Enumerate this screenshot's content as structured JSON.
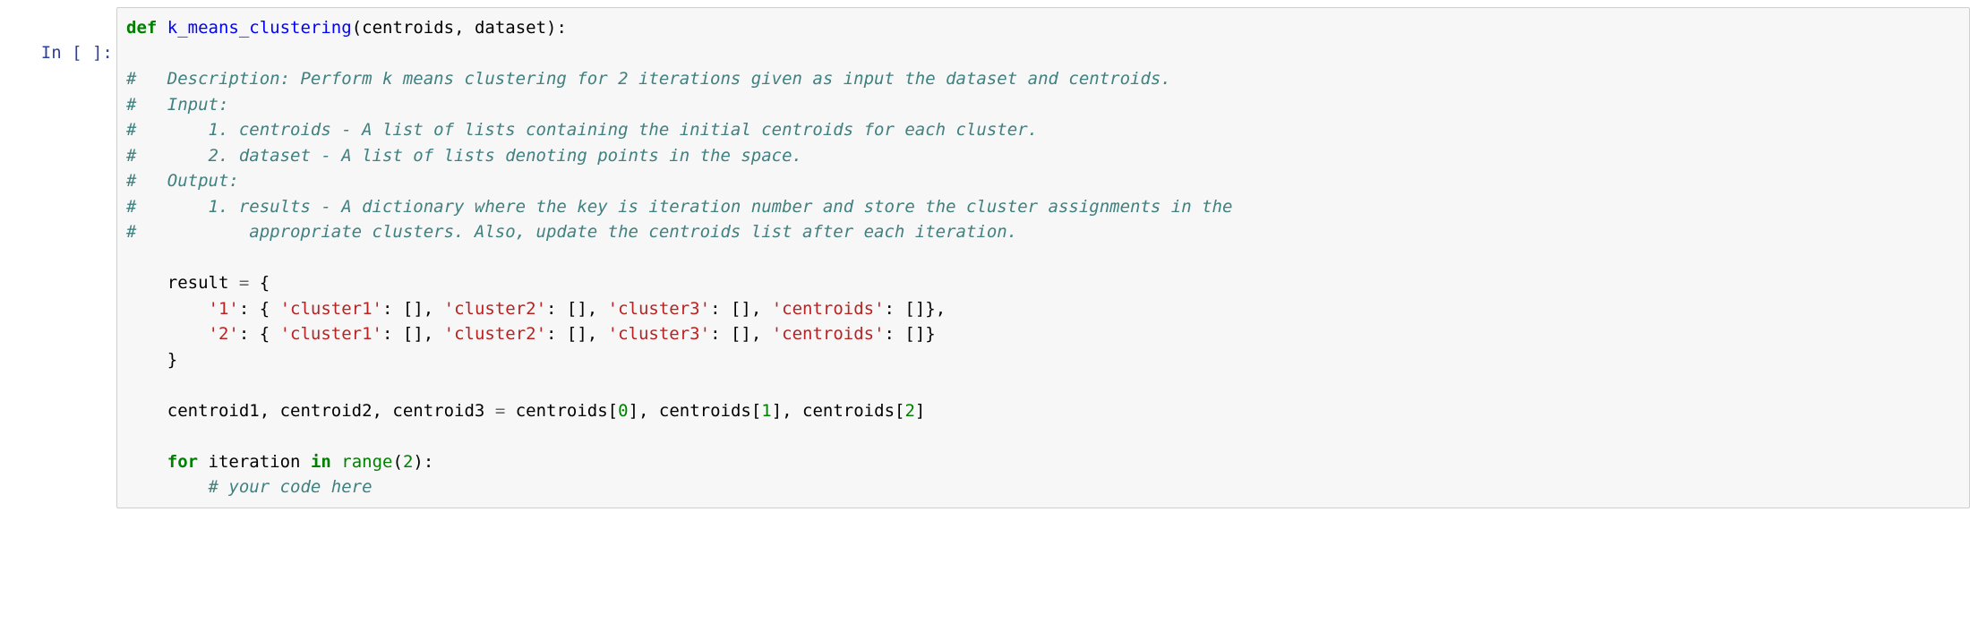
{
  "cell": {
    "prompt": "In [ ]:",
    "code": {
      "l1": {
        "def": "def",
        "name": "k_means_clustering",
        "params": "(centroids, dataset):"
      },
      "l2": "",
      "l3": "#   Description: Perform k means clustering for 2 iterations given as input the dataset and centroids.",
      "l4": "#   Input:",
      "l5": "#       1. centroids - A list of lists containing the initial centroids for each cluster. ",
      "l6": "#       2. dataset - A list of lists denoting points in the space.",
      "l7": "#   Output:",
      "l8": "#       1. results - A dictionary where the key is iteration number and store the cluster assignments in the ",
      "l9": "#           appropriate clusters. Also, update the centroids list after each iteration.",
      "l10": "",
      "l11": {
        "pre": "    result ",
        "op": "=",
        "post": " {"
      },
      "l12": {
        "indent": "        ",
        "s1": "'1'",
        "c1": ": { ",
        "s2": "'cluster1'",
        "c2": ": [], ",
        "s3": "'cluster2'",
        "c3": ": [], ",
        "s4": "'cluster3'",
        "c4": ": [], ",
        "s5": "'centroids'",
        "c5": ": []},"
      },
      "l13": {
        "indent": "        ",
        "s1": "'2'",
        "c1": ": { ",
        "s2": "'cluster1'",
        "c2": ": [], ",
        "s3": "'cluster2'",
        "c3": ": [], ",
        "s4": "'cluster3'",
        "c4": ": [], ",
        "s5": "'centroids'",
        "c5": ": []}"
      },
      "l14": "    }",
      "l15": "",
      "l16": {
        "pre": "    centroid1, centroid2, centroid3 ",
        "op": "=",
        "mid1": " centroids[",
        "n0": "0",
        "mid2": "], centroids[",
        "n1": "1",
        "mid3": "], centroids[",
        "n2": "2",
        "end": "]"
      },
      "l17": "",
      "l18": {
        "indent": "    ",
        "for": "for",
        "sp1": " iteration ",
        "in": "in",
        "sp2": " ",
        "range": "range",
        "open": "(",
        "n": "2",
        "close": "):"
      },
      "l19": {
        "indent": "        ",
        "comment": "# your code here"
      }
    }
  }
}
